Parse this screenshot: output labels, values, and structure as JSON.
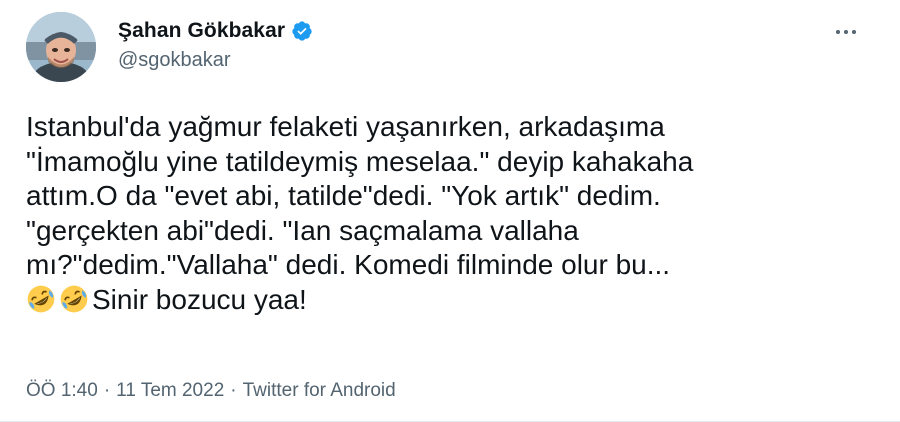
{
  "author": {
    "display_name": "Şahan Gökbakar",
    "handle": "@sgokbakar",
    "verified": true
  },
  "tweet": {
    "lines": [
      "Istanbul'da yağmur felaketi yaşanırken, arkadaşıma",
      "\"İmamoğlu yine tatildeymiş meselaa.\" deyip kahakaha",
      "attım.O da \"evet abi, tatilde\"dedi. \"Yok artık\" dedim.",
      "\"gerçekten abi\"dedi. \"Ian saçmalama vallaha",
      "mı?\"dedim.\"Vallaha\" dedi. Komedi filminde olur bu..."
    ],
    "last_line_text": "Sinir bozucu yaa!",
    "last_line_emojis": [
      "rolling-on-floor-laughing-icon",
      "rolling-on-floor-laughing-icon"
    ]
  },
  "meta": {
    "time": "ÖÖ 1:40",
    "date": "11 Tem 2022",
    "separator": "·",
    "source": "Twitter for Android"
  },
  "colors": {
    "text": "#0f1419",
    "secondary": "#536471",
    "verified": "#1d9bf0"
  }
}
